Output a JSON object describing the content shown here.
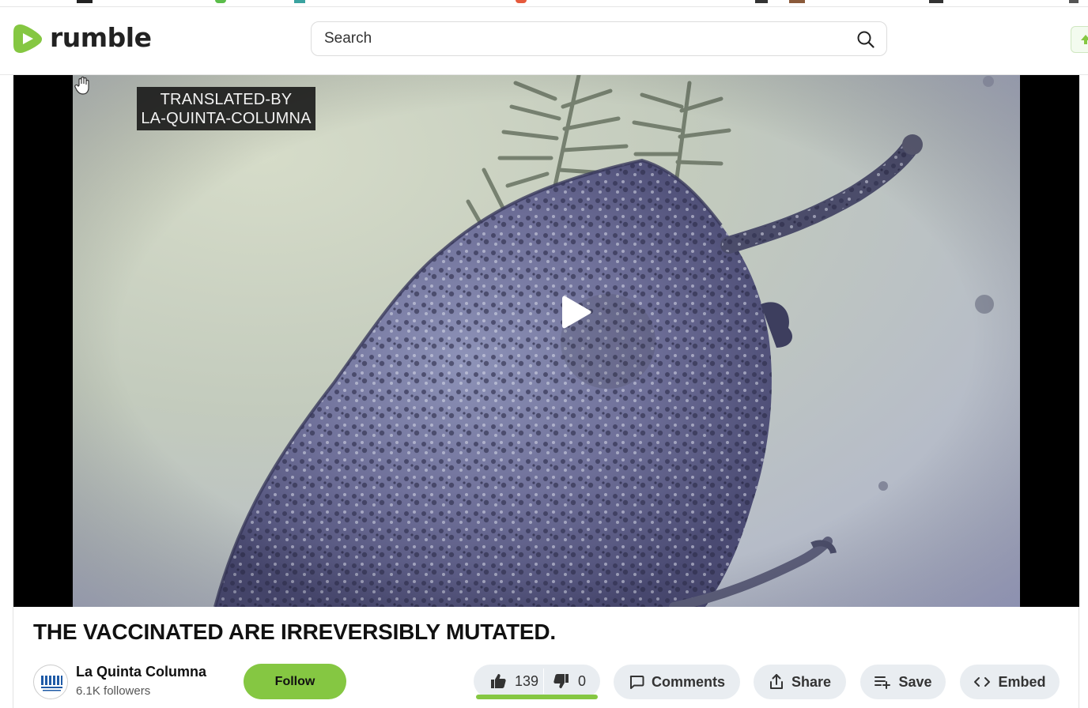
{
  "brand": {
    "name": "rumble",
    "accent_color": "#85c742"
  },
  "search": {
    "placeholder": "Search",
    "icon": "search-icon"
  },
  "video": {
    "watermark_line1": "TRANSLATED-BY",
    "watermark_line2": "LA-QUINTA-COLUMNA",
    "title": "THE VACCINATED ARE IRREVERSIBLY MUTATED.",
    "play_icon": "play-icon"
  },
  "channel": {
    "name": "La Quinta Columna",
    "followers": "6.1K followers",
    "follow_label": "Follow"
  },
  "votes": {
    "likes": "139",
    "dislikes": "0",
    "like_ratio": 1.0
  },
  "actions": {
    "comments_label": "Comments",
    "share_label": "Share",
    "save_label": "Save",
    "embed_label": "Embed"
  }
}
